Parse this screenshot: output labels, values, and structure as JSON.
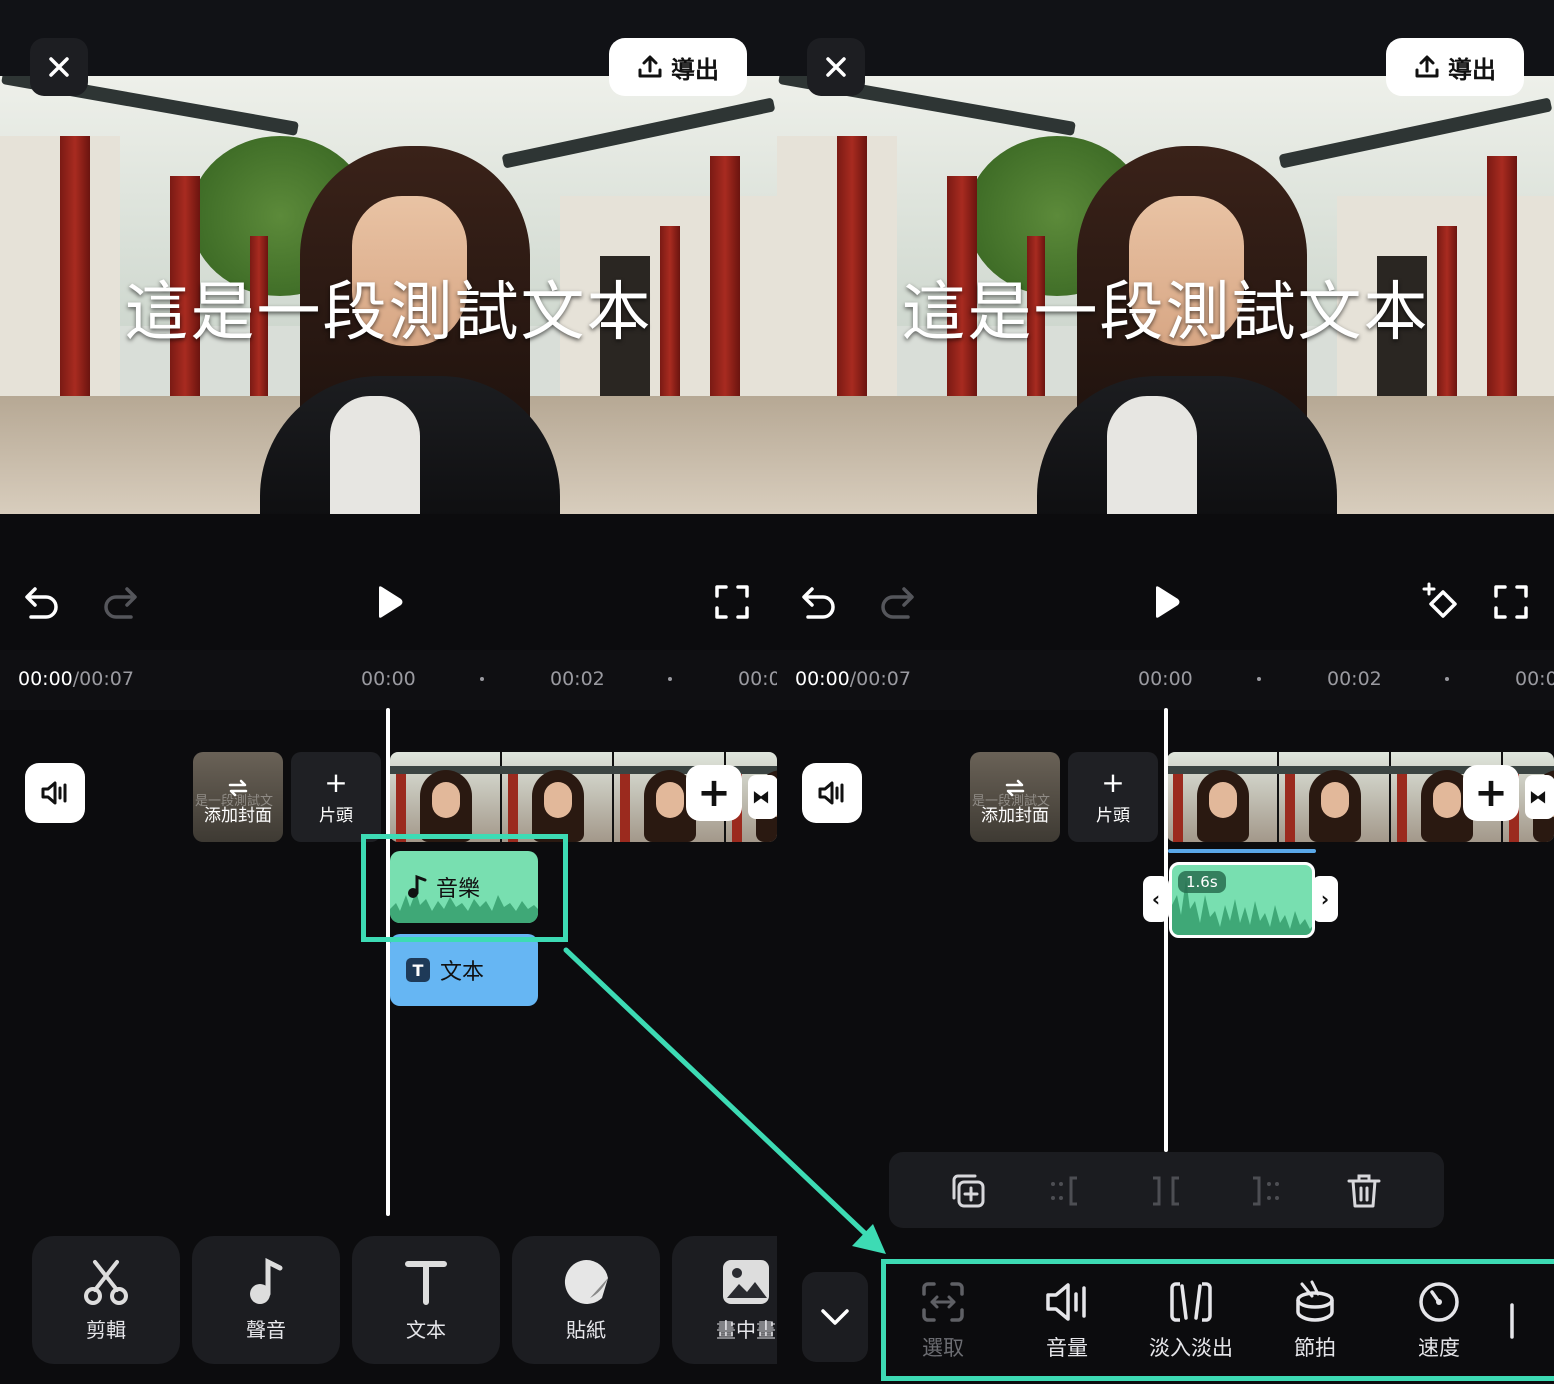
{
  "colors": {
    "accent": "#3ddbb4",
    "music_clip": "#78dfb0",
    "text_clip": "#66b6f3",
    "background": "#0c0c0e"
  },
  "left": {
    "export_label": "導出",
    "caption": "這是一段測試文本",
    "time_current": "00:00",
    "time_total": "/00:07",
    "ticks": [
      "00:00",
      "00:02",
      "00:0"
    ],
    "cover_ghost": "是一段測試文",
    "cover_label": "添加封面",
    "intro_label": "片頭",
    "music_label": "音樂",
    "text_label": "文本",
    "tools": [
      {
        "label": "剪輯",
        "icon": "scissors-icon"
      },
      {
        "label": "聲音",
        "icon": "music-note-icon"
      },
      {
        "label": "文本",
        "icon": "text-icon"
      },
      {
        "label": "貼紙",
        "icon": "sticker-icon"
      },
      {
        "label": "畫中畫",
        "icon": "picture-in-picture-icon"
      }
    ]
  },
  "right": {
    "export_label": "導出",
    "caption": "這是一段測試文本",
    "time_current": "00:00",
    "time_total": "/00:07",
    "ticks": [
      "00:00",
      "00:02",
      "00:0"
    ],
    "cover_ghost": "是一段測試文",
    "cover_label": "添加封面",
    "intro_label": "片頭",
    "clip_duration": "1.6s",
    "tools": [
      {
        "label": "選取",
        "icon": "select-icon",
        "enabled": false
      },
      {
        "label": "音量",
        "icon": "volume-icon",
        "enabled": true
      },
      {
        "label": "淡入淡出",
        "icon": "fade-icon",
        "enabled": true
      },
      {
        "label": "節拍",
        "icon": "beat-icon",
        "enabled": true
      },
      {
        "label": "速度",
        "icon": "speed-icon",
        "enabled": true
      }
    ]
  }
}
